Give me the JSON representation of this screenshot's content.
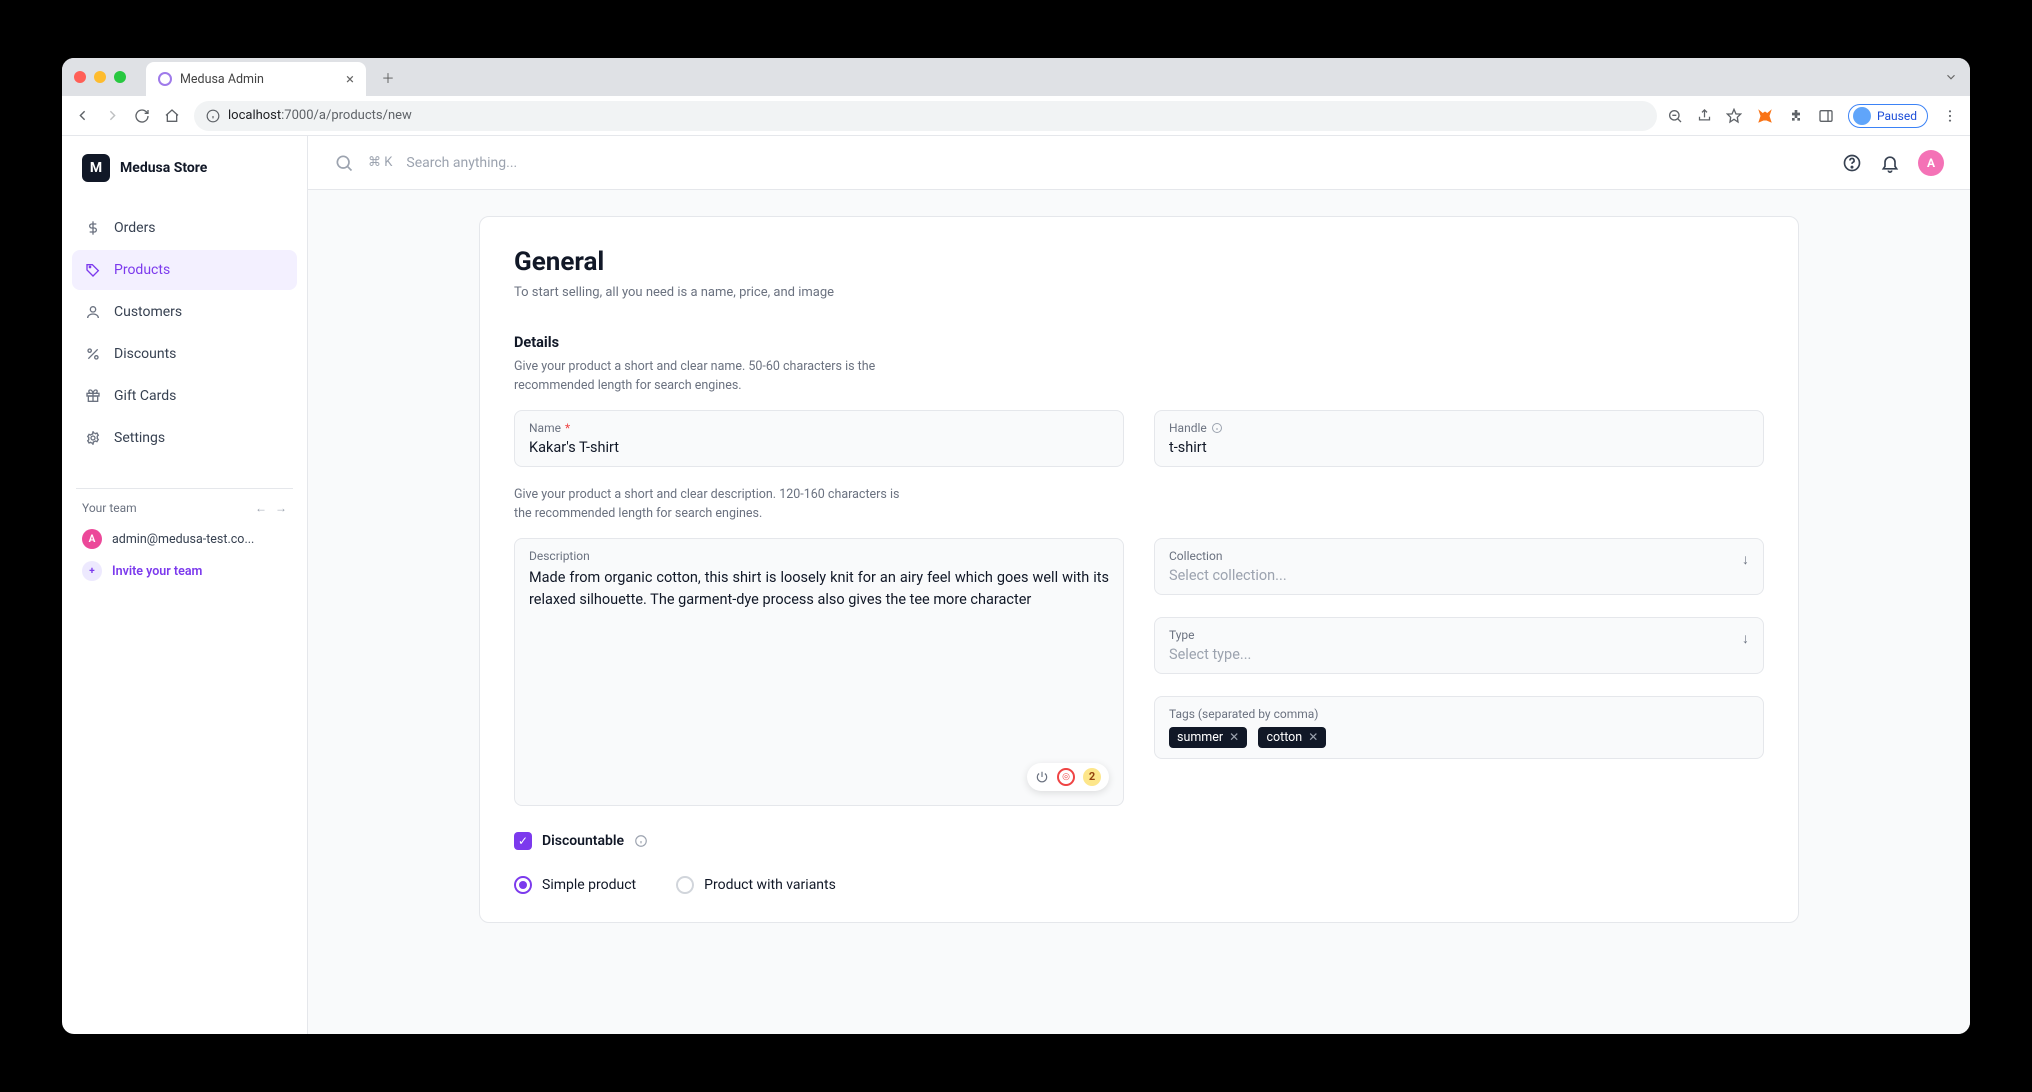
{
  "browser": {
    "tab_title": "Medusa Admin",
    "url_host": "localhost",
    "url_port_path": ":7000/a/products/new",
    "profile_status": "Paused"
  },
  "brand": {
    "logo_letter": "M",
    "name": "Medusa Store"
  },
  "nav": {
    "items": [
      {
        "label": "Orders"
      },
      {
        "label": "Products"
      },
      {
        "label": "Customers"
      },
      {
        "label": "Discounts"
      },
      {
        "label": "Gift Cards"
      },
      {
        "label": "Settings"
      }
    ]
  },
  "team": {
    "title": "Your team",
    "admin_email": "admin@medusa-test.co...",
    "admin_initial": "A",
    "invite_label": "Invite your team"
  },
  "topbar": {
    "shortcut": "⌘ K",
    "search_placeholder": "Search anything...",
    "avatar_initial": "A"
  },
  "form": {
    "title": "General",
    "subtitle": "To start selling, all you need is a name, price, and image",
    "details_h": "Details",
    "details_hint": "Give your product a short and clear name. 50-60 characters is the recommended length for search engines.",
    "name_label": "Name",
    "name_value": "Kakar's T-shirt",
    "handle_label": "Handle",
    "handle_value": "t-shirt",
    "desc_hint": "Give your product a short and clear description. 120-160 characters is the recommended length for search engines.",
    "desc_label": "Description",
    "desc_value": "Made from organic cotton, this shirt is loosely knit for an airy feel which goes well with its relaxed silhouette. The garment-dye process also gives the tee more character",
    "collection_label": "Collection",
    "collection_placeholder": "Select collection...",
    "type_label": "Type",
    "type_placeholder": "Select type...",
    "tags_label": "Tags (separated by comma)",
    "tags": [
      "summer",
      "cotton"
    ],
    "discountable_label": "Discountable",
    "radio_simple": "Simple product",
    "radio_variants": "Product with variants",
    "grammar_count": "2"
  }
}
